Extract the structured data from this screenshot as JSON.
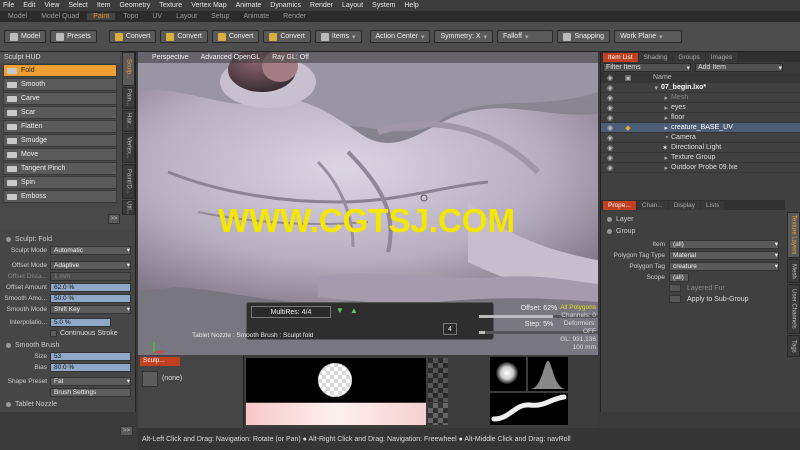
{
  "menubar": {
    "items": [
      "File",
      "Edit",
      "View",
      "Select",
      "Item",
      "Geometry",
      "Texture",
      "Vertex Map",
      "Animate",
      "Dynamics",
      "Render",
      "Layout",
      "System",
      "Help"
    ]
  },
  "tabs": [
    "Model",
    "Model Quad",
    "Paint",
    "Topo",
    "UV",
    "Layout",
    "Setup",
    "Animate",
    "Render"
  ],
  "active_tab": "Paint",
  "toolbar": {
    "model_label": "Model",
    "presets_label": "Presets",
    "convert1": "Convert",
    "convert2": "Convert",
    "convert3": "Convert",
    "convert4": "Convert",
    "items": "Items",
    "action_center": "Action Center",
    "symmetry": "Symmetry: X",
    "falloff": "Falloff",
    "snapping": "Snapping",
    "work_plane": "Work Plane"
  },
  "left": {
    "header": "Sculpt HUD",
    "tools": [
      "Fold",
      "Smooth",
      "Carve",
      "Scar",
      "Flatten",
      "Smudge",
      "Move",
      "Tangent Pinch",
      "Spin",
      "Emboss"
    ],
    "vtabs": [
      "Sculp...",
      "Pain...",
      "Hair...",
      "Vertex...",
      "Paint/D...",
      "Util..."
    ],
    "more": ">>"
  },
  "lower_left": {
    "sculpt_title": "Sculpt: Fold",
    "sculpt_mode_label": "Sculpt Mode",
    "sculpt_mode": "Automatic",
    "offset_mode_label": "Offset Mode",
    "offset_mode": "Adaptive",
    "offset_dist_label": "Offset Dista...",
    "offset_dist": "1 mm",
    "offset_amount_label": "Offset Amount",
    "offset_amount": "62.0 %",
    "smooth_amount_label": "Smooth Amo...",
    "smooth_amount": "50.0 %",
    "smooth_mode_label": "Smooth Mode",
    "smooth_mode": "Shift Key",
    "interp_label": "Interpolatio...",
    "interp": "5.0 %",
    "continuous": "Continuous Stroke",
    "smooth_brush": "Smooth Brush",
    "size_label": "Size",
    "size": "53",
    "bias_label": "Bias",
    "bias": "80.0 %",
    "shape_preset_label": "Shape Preset",
    "shape_preset": "Fat",
    "brush_settings": "Brush Settings",
    "tablet_nozzle": "Tablet Nozzle",
    "more": ">>"
  },
  "viewport": {
    "view": "Perspective",
    "shading": "Advanced OpenGL",
    "ray": "Ray GL: Off",
    "watermark": "WWW.CGTSJ.COM",
    "multires": "MultiRes: 4/4",
    "offset": "Offset:  62%",
    "step": "Step:   5%",
    "step_num": "4",
    "nozzle_text": "Tablet Nozzle : Smooth Brush : Sculpt fold",
    "stats": {
      "mode": "All Polygons",
      "channels": "Channels: 0",
      "deformers": "Deformers: OFF",
      "gl": "GL: 931,136",
      "scale": "100 mm"
    }
  },
  "right": {
    "top_tabs": [
      "Item List",
      "Shading",
      "Groups",
      "Images"
    ],
    "filter": "Filter Items",
    "add_item": "Add Item",
    "name_col": "Name",
    "items": [
      {
        "name": "07_begin.lxo*",
        "indent": 0
      },
      {
        "name": "Mesh",
        "indent": 2
      },
      {
        "name": "eyes",
        "indent": 2
      },
      {
        "name": "floor",
        "indent": 2
      },
      {
        "name": "creature_BASE_UV",
        "indent": 2
      },
      {
        "name": "Camera",
        "indent": 2
      },
      {
        "name": "Directional Light",
        "indent": 2
      },
      {
        "name": "Texture Group",
        "indent": 2
      },
      {
        "name": "Outdoor Probe 09.lxe",
        "indent": 2
      }
    ],
    "bottom_tabs": [
      "Prope...",
      "Chan...",
      "Display",
      "Lists"
    ],
    "layer": "Layer",
    "group": "Group",
    "item_label": "Item",
    "item_val": "(all)",
    "ptt_label": "Polygon Tag Type",
    "ptt_val": "Material",
    "pt_label": "Polygon Tag",
    "pt_val": "creature",
    "scope_label": "Scope",
    "scope_val": "(all)",
    "layered_fur": "Layered Fur",
    "apply_sub": "Apply to Sub-Group",
    "side_tabs": [
      "Texture Layers",
      "Mesh",
      "User Channels",
      "Tags"
    ]
  },
  "bottom": {
    "tab": "Sculp...",
    "none": "(none)"
  },
  "status": "Alt-Left Click and Drag: Navigation: Rotate (or Pan) ● Alt-Right Click and Drag: Navigation: Freewheel ● Alt-Middle Click and Drag: navRoll"
}
